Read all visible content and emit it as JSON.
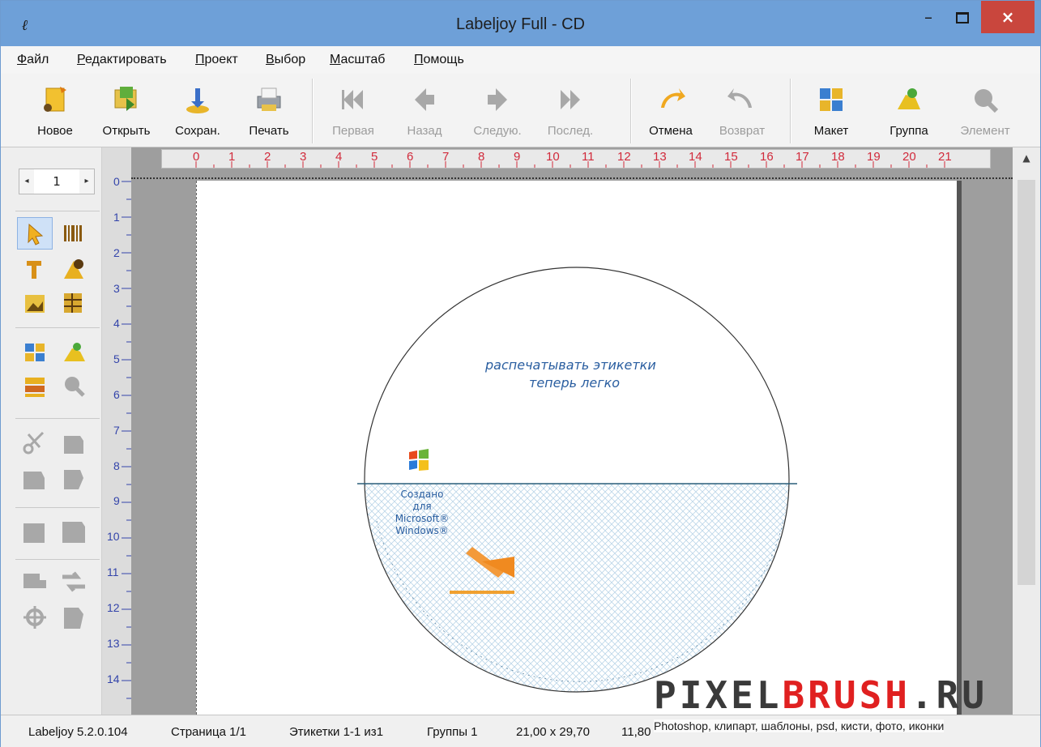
{
  "window": {
    "title": "Labeljoy Full - CD",
    "minimize": "–",
    "close": "×"
  },
  "menu": [
    {
      "label": "Файл",
      "underline": "Ф",
      "rest": "айл"
    },
    {
      "label": "Редактировать",
      "underline": "Р",
      "rest": "едактировать"
    },
    {
      "label": "Проект",
      "underline": "П",
      "rest": "роект"
    },
    {
      "label": "Выбор",
      "underline": "В",
      "rest": "ыбор"
    },
    {
      "label": "Масштаб",
      "underline": "М",
      "rest": "асштаб"
    },
    {
      "label": "Помощь",
      "underline": "П",
      "rest": "омощь"
    }
  ],
  "toolbar": [
    {
      "label": "Новое",
      "icon": "new-icon",
      "enabled": true
    },
    {
      "label": "Открыть",
      "icon": "open-icon",
      "enabled": true
    },
    {
      "label": "Сохран.",
      "icon": "save-icon",
      "enabled": true
    },
    {
      "label": "Печать",
      "icon": "print-icon",
      "enabled": true
    },
    {
      "label": "Первая",
      "icon": "first-icon",
      "enabled": false
    },
    {
      "label": "Назад",
      "icon": "back-icon",
      "enabled": false
    },
    {
      "label": "Следую.",
      "icon": "next-icon",
      "enabled": false
    },
    {
      "label": "Послед.",
      "icon": "last-icon",
      "enabled": false
    },
    {
      "label": "Отмена",
      "icon": "undo-icon",
      "enabled": true
    },
    {
      "label": "Возврат",
      "icon": "redo-icon",
      "enabled": false
    },
    {
      "label": "Макет",
      "icon": "layout-icon",
      "enabled": true
    },
    {
      "label": "Группа",
      "icon": "group-icon",
      "enabled": true
    },
    {
      "label": "Элемент",
      "icon": "element-icon",
      "enabled": false
    }
  ],
  "pager": {
    "page": "1",
    "prev": "◂",
    "next": "▸"
  },
  "hruler": [
    "0",
    "1",
    "2",
    "3",
    "4",
    "5",
    "6",
    "7",
    "8",
    "9",
    "10",
    "11",
    "12",
    "13",
    "14",
    "15",
    "16",
    "17",
    "18",
    "19",
    "20",
    "21"
  ],
  "vruler": [
    "0",
    "1",
    "2",
    "3",
    "4",
    "5",
    "6",
    "7",
    "8",
    "9",
    "10",
    "11",
    "12",
    "13",
    "14"
  ],
  "label": {
    "line1": "распечатывать этикетки",
    "line2": "теперь легко",
    "badge": [
      "Создано",
      "для",
      "Microsoft®",
      "Windows®"
    ]
  },
  "status": {
    "version": "Labeljoy 5.2.0.104",
    "page": "Страница 1/1",
    "labels": "Этикетки 1-1 из1",
    "groups": "Группы 1",
    "size": "21,00 x 29,70",
    "pos": "11,80"
  },
  "watermark": {
    "pre": "PIXEL",
    "brand": "BRUSH",
    "post": ".RU",
    "sub": "Photoshop, клипарт, шаблоны, psd, кисти, фото, иконки"
  },
  "colors": {
    "titlebar": "#6ea0d8",
    "close": "#c9463d",
    "ruler_text": "#d12a3b",
    "vruler_text": "#3344aa"
  }
}
